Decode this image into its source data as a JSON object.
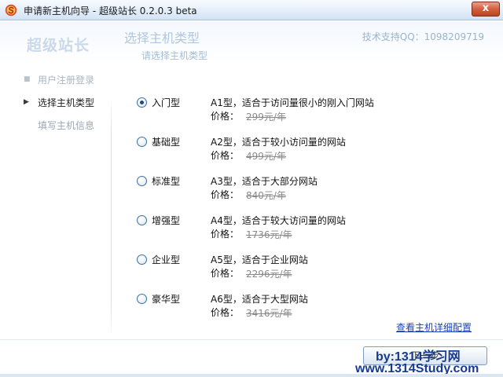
{
  "window": {
    "title": "申请新主机向导 - 超级站长 0.2.0.3 beta",
    "close_label": "x"
  },
  "header": {
    "brand": "超级站长",
    "title": "选择主机类型",
    "subtitle": "请选择主机类型",
    "support": "技术支持QQ：1098209719"
  },
  "sidebar": {
    "items": [
      {
        "label": "用户注册登录",
        "state": "done",
        "marker": "■"
      },
      {
        "label": "选择主机类型",
        "state": "active",
        "marker": "▶"
      },
      {
        "label": "填写主机信息",
        "state": "pending",
        "marker": ""
      }
    ]
  },
  "options": [
    {
      "name": "入门型",
      "desc": "A1型，适合于访问量很小的刚入门网站",
      "price_label": "价格：",
      "price": "299元/年",
      "selected": true
    },
    {
      "name": "基础型",
      "desc": "A2型，适合于较小访问量的网站",
      "price_label": "价格：",
      "price": "499元/年",
      "selected": false
    },
    {
      "name": "标准型",
      "desc": "A3型，适合于大部分网站",
      "price_label": "价格：",
      "price": "840元/年",
      "selected": false
    },
    {
      "name": "增强型",
      "desc": "A4型，适合于较大访问量的网站",
      "price_label": "价格：",
      "price": "1736元/年",
      "selected": false
    },
    {
      "name": "企业型",
      "desc": "A5型，适合于企业网站",
      "price_label": "价格：",
      "price": "2296元/年",
      "selected": false
    },
    {
      "name": "豪华型",
      "desc": "A6型，适合于大型网站",
      "price_label": "价格：",
      "price": "3416元/年",
      "selected": false
    }
  ],
  "footer": {
    "details_link": "查看主机详细配置",
    "next_button": "下一步",
    "watermark_line1": "by:1314学习网",
    "watermark_line2": "www.1314Study.com"
  }
}
